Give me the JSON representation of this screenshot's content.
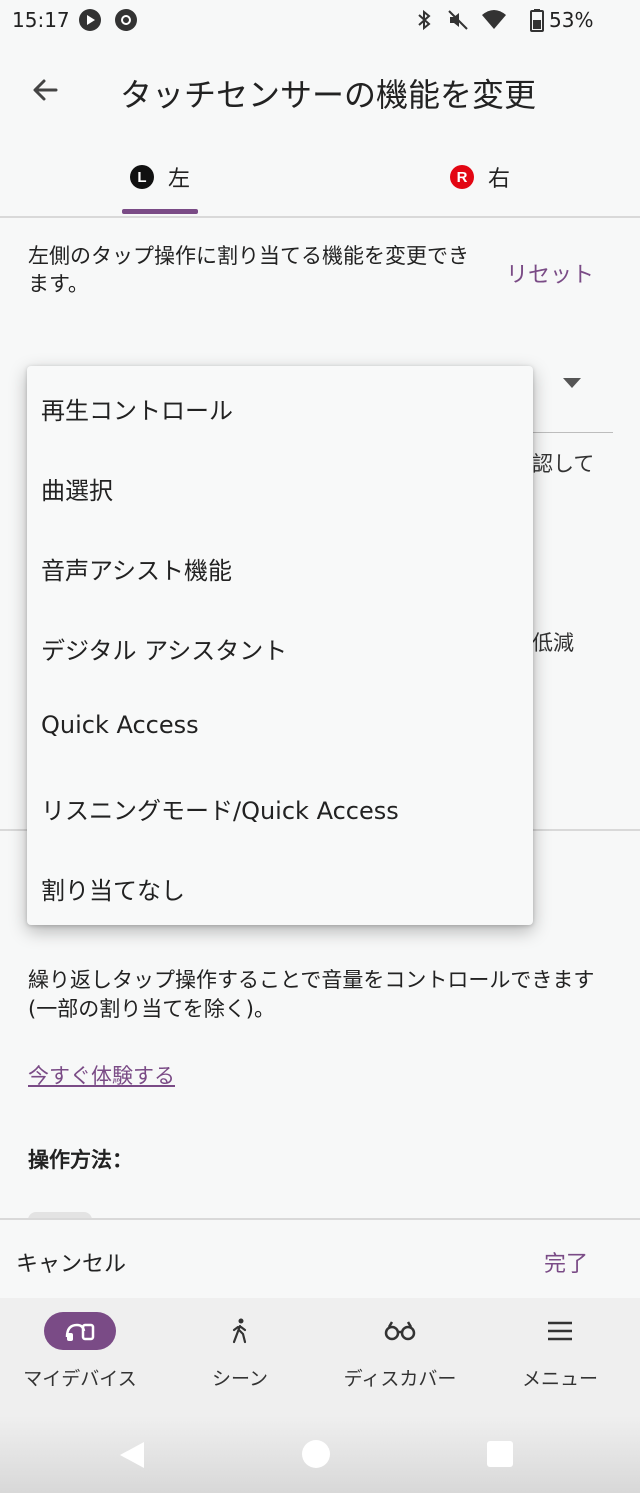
{
  "status_bar": {
    "time": "15:17",
    "battery": "53%",
    "icons": [
      "play-badge-icon",
      "settings-badge-icon",
      "bluetooth-icon",
      "mute-icon",
      "wifi-icon",
      "battery-icon"
    ]
  },
  "app_bar": {
    "back_icon": "arrow-left-icon",
    "title": "タッチセンサーの機能を変更"
  },
  "tabs": [
    {
      "badge": "L",
      "label": "左",
      "badge_color": "#111111",
      "selected": true
    },
    {
      "badge": "R",
      "label": "右",
      "badge_color": "#e30613",
      "selected": false
    }
  ],
  "content": {
    "description": "左側のタップ操作に割り当てる機能を変更できます。",
    "reset_label": "リセット",
    "peek_text_1": "認して",
    "peek_text_2": "低減",
    "volume_description": "繰り返しタップ操作することで音量をコントロールできます (一部の割り当てを除く)。",
    "try_link": "今すぐ体験する",
    "how_to_label": "操作方法："
  },
  "dropdown_menu": {
    "items": [
      "再生コントロール",
      "曲選択",
      "音声アシスト機能",
      "デジタル アシスタント",
      "Quick Access",
      "リスニングモード/Quick Access",
      "割り当てなし"
    ]
  },
  "action_bar": {
    "cancel_label": "キャンセル",
    "done_label": "完了"
  },
  "bottom_nav": [
    {
      "label": "マイデバイス",
      "icon": "headphones-device-icon",
      "active": true
    },
    {
      "label": "シーン",
      "icon": "walking-person-icon",
      "active": false
    },
    {
      "label": "ディスカバー",
      "icon": "binoculars-icon",
      "active": false
    },
    {
      "label": "メニュー",
      "icon": "hamburger-menu-icon",
      "active": false
    }
  ],
  "colors": {
    "accent": "#7a4b86",
    "background": "#f7f8f8",
    "right_badge": "#e30613"
  }
}
